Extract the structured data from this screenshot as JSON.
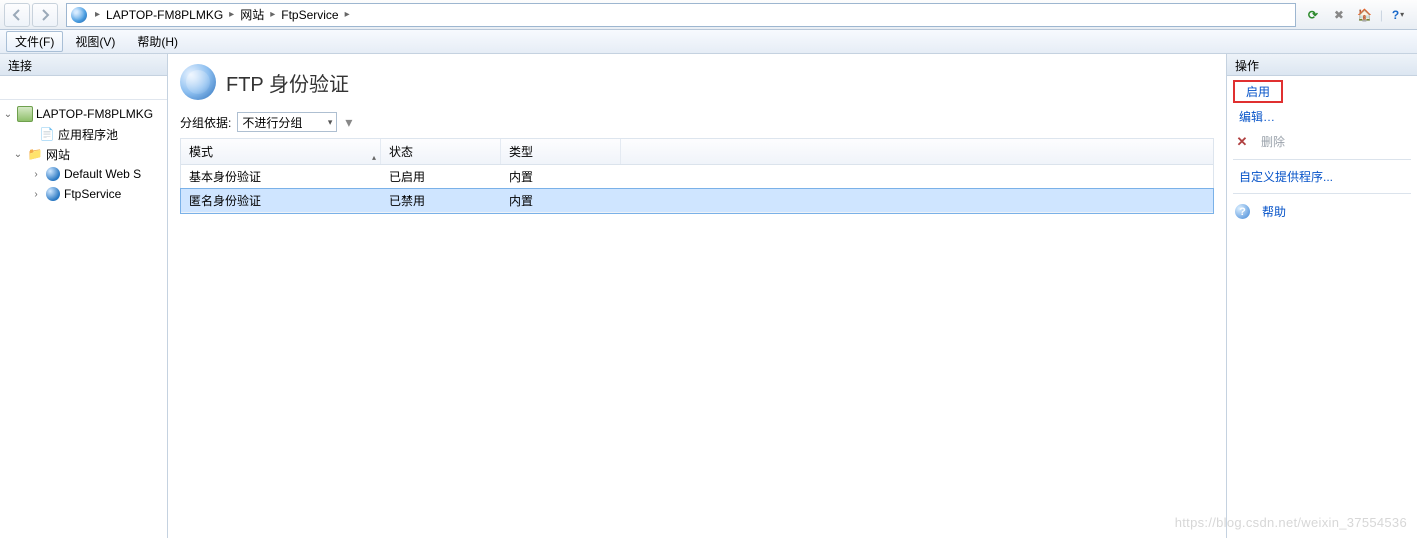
{
  "breadcrumb": {
    "items": [
      "LAPTOP-FM8PLMKG",
      "网站",
      "FtpService"
    ]
  },
  "menubar": {
    "file": "文件(F)",
    "view": "视图(V)",
    "help": "帮助(H)"
  },
  "left": {
    "header": "连接",
    "tree": {
      "root": "LAPTOP-FM8PLMKG",
      "app_pool": "应用程序池",
      "sites": "网站",
      "default_site": "Default Web S",
      "ftp_service": "FtpService"
    }
  },
  "center": {
    "title": "FTP 身份验证",
    "group_by_label": "分组依据:",
    "group_by_value": "不进行分组",
    "columns": {
      "mode": "模式",
      "status": "状态",
      "type": "类型"
    },
    "rows": [
      {
        "mode": "基本身份验证",
        "status": "已启用",
        "type": "内置"
      },
      {
        "mode": "匿名身份验证",
        "status": "已禁用",
        "type": "内置"
      }
    ]
  },
  "right": {
    "header": "操作",
    "enable": "启用",
    "edit": "编辑…",
    "delete": "删除",
    "custom_providers": "自定义提供程序...",
    "help": "帮助"
  },
  "watermark": "https://blog.csdn.net/weixin_37554536"
}
